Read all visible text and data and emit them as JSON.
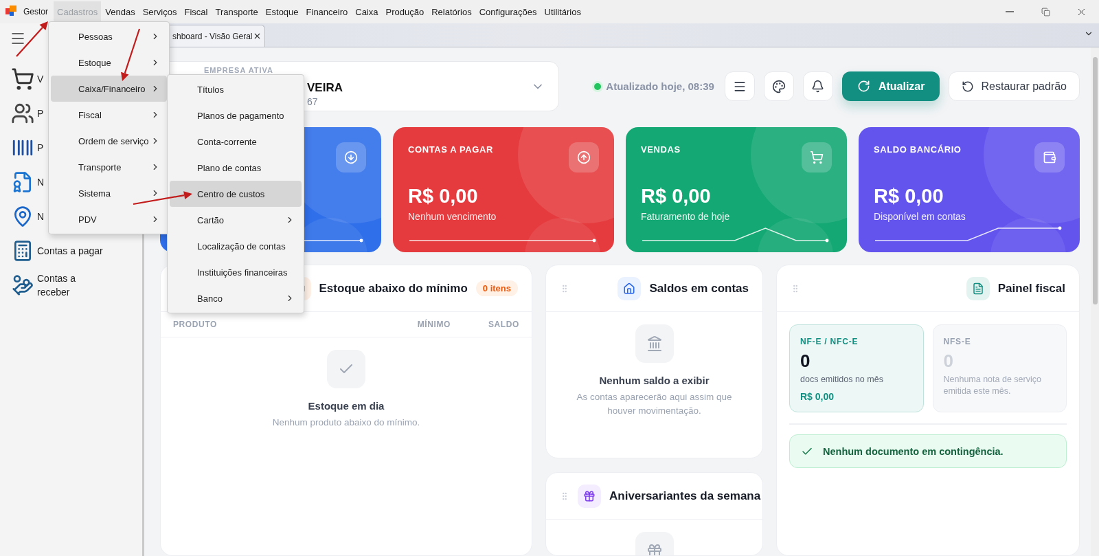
{
  "menubar": {
    "app": "Gestor",
    "items": [
      {
        "label": "Cadastros",
        "selected": true
      },
      {
        "label": "Vendas",
        "selected": false
      },
      {
        "label": "Serviços",
        "selected": false
      },
      {
        "label": "Fiscal",
        "selected": false
      },
      {
        "label": "Transporte",
        "selected": false
      },
      {
        "label": "Estoque",
        "selected": false
      },
      {
        "label": "Financeiro",
        "selected": false
      },
      {
        "label": "Caixa",
        "selected": false
      },
      {
        "label": "Produção",
        "selected": false
      },
      {
        "label": "Relatórios",
        "selected": false
      },
      {
        "label": "Configurações",
        "selected": false
      },
      {
        "label": "Utilitários",
        "selected": false
      }
    ]
  },
  "sidebar": {
    "items": [
      {
        "kind": "cart",
        "label": "V"
      },
      {
        "kind": "people",
        "label": "P"
      },
      {
        "kind": "barcode",
        "label": "P"
      },
      {
        "kind": "nfse",
        "label": "N"
      },
      {
        "kind": "nfe",
        "label": "N"
      },
      {
        "kind": "payable",
        "label": "Contas a pagar"
      },
      {
        "kind": "receivable",
        "label": "Contas a receber"
      }
    ]
  },
  "tabs": [
    {
      "label": "shboard - Visão Geral",
      "selected": true
    }
  ],
  "menu": {
    "items": [
      {
        "label": "Pessoas",
        "submenu": true,
        "selected": false
      },
      {
        "label": "Estoque",
        "submenu": true,
        "selected": false
      },
      {
        "label": "Caixa/Financeiro",
        "submenu": true,
        "selected": true
      },
      {
        "label": "Fiscal",
        "submenu": true,
        "selected": false
      },
      {
        "label": "Ordem de serviço",
        "submenu": true,
        "selected": false
      },
      {
        "label": "Transporte",
        "submenu": true,
        "selected": false
      },
      {
        "label": "Sistema",
        "submenu": true,
        "selected": false
      },
      {
        "label": "PDV",
        "submenu": true,
        "selected": false
      }
    ]
  },
  "submenu": {
    "items": [
      {
        "label": "Títulos",
        "submenu": false,
        "selected": false
      },
      {
        "label": "Planos de pagamento",
        "submenu": false,
        "selected": false
      },
      {
        "label": "Conta-corrente",
        "submenu": false,
        "selected": false
      },
      {
        "label": "Plano de contas",
        "submenu": false,
        "selected": false
      },
      {
        "label": "Centro de custos",
        "submenu": false,
        "selected": true
      },
      {
        "label": "Cartão",
        "submenu": true,
        "selected": false
      },
      {
        "label": "Localização de contas",
        "submenu": false,
        "selected": false
      },
      {
        "label": "Instituições financeiras",
        "submenu": false,
        "selected": false
      },
      {
        "label": "Banco",
        "submenu": true,
        "selected": false
      }
    ]
  },
  "company": {
    "label": "EMPRESA ATIVA",
    "name": "VEIRA",
    "code": "67"
  },
  "status": {
    "text": "Atualizado hoje, 08:39"
  },
  "actions": {
    "refresh": "Atualizar",
    "reset": "Restaurar padrão"
  },
  "kpis": [
    {
      "kind": "receivable",
      "color": "#2f6fea"
    },
    {
      "kind": "payable",
      "color": "#e53b3e",
      "title": "CONTAS A PAGAR",
      "value": "R$ 0,00",
      "caption": "Nenhum vencimento"
    },
    {
      "kind": "sales",
      "color": "#14a874",
      "title": "VENDAS",
      "value": "R$ 0,00",
      "caption": "Faturamento de hoje"
    },
    {
      "kind": "bank",
      "color": "#6354ee",
      "title": "SALDO BANCÁRIO",
      "value": "R$ 0,00",
      "caption": "Disponível em contas"
    }
  ],
  "stock": {
    "title": "Estoque abaixo do mínimo",
    "badge": "0 itens",
    "columns": [
      "PRODUTO",
      "MÍNIMO",
      "SALDO"
    ],
    "empty_title": "Estoque em dia",
    "empty_text": "Nenhum produto abaixo do mínimo."
  },
  "balances": {
    "title": "Saldos em contas",
    "empty_title": "Nenhum saldo a exibir",
    "empty_text": "As contas aparecerão aqui assim que houver movimentação."
  },
  "birthdays": {
    "title": "Aniversariantes da semana"
  },
  "fiscal": {
    "title": "Painel fiscal",
    "boxes": [
      {
        "label": "NF-E / NFC-E",
        "count": "0",
        "caption": "docs emitidos no mês",
        "amount": "R$ 0,00",
        "active": true
      },
      {
        "label": "NFS-E",
        "count": "0",
        "caption": "Nenhuma nota de serviço emitida este mês.",
        "active": false
      }
    ],
    "alert": "Nenhum documento em contingência."
  }
}
